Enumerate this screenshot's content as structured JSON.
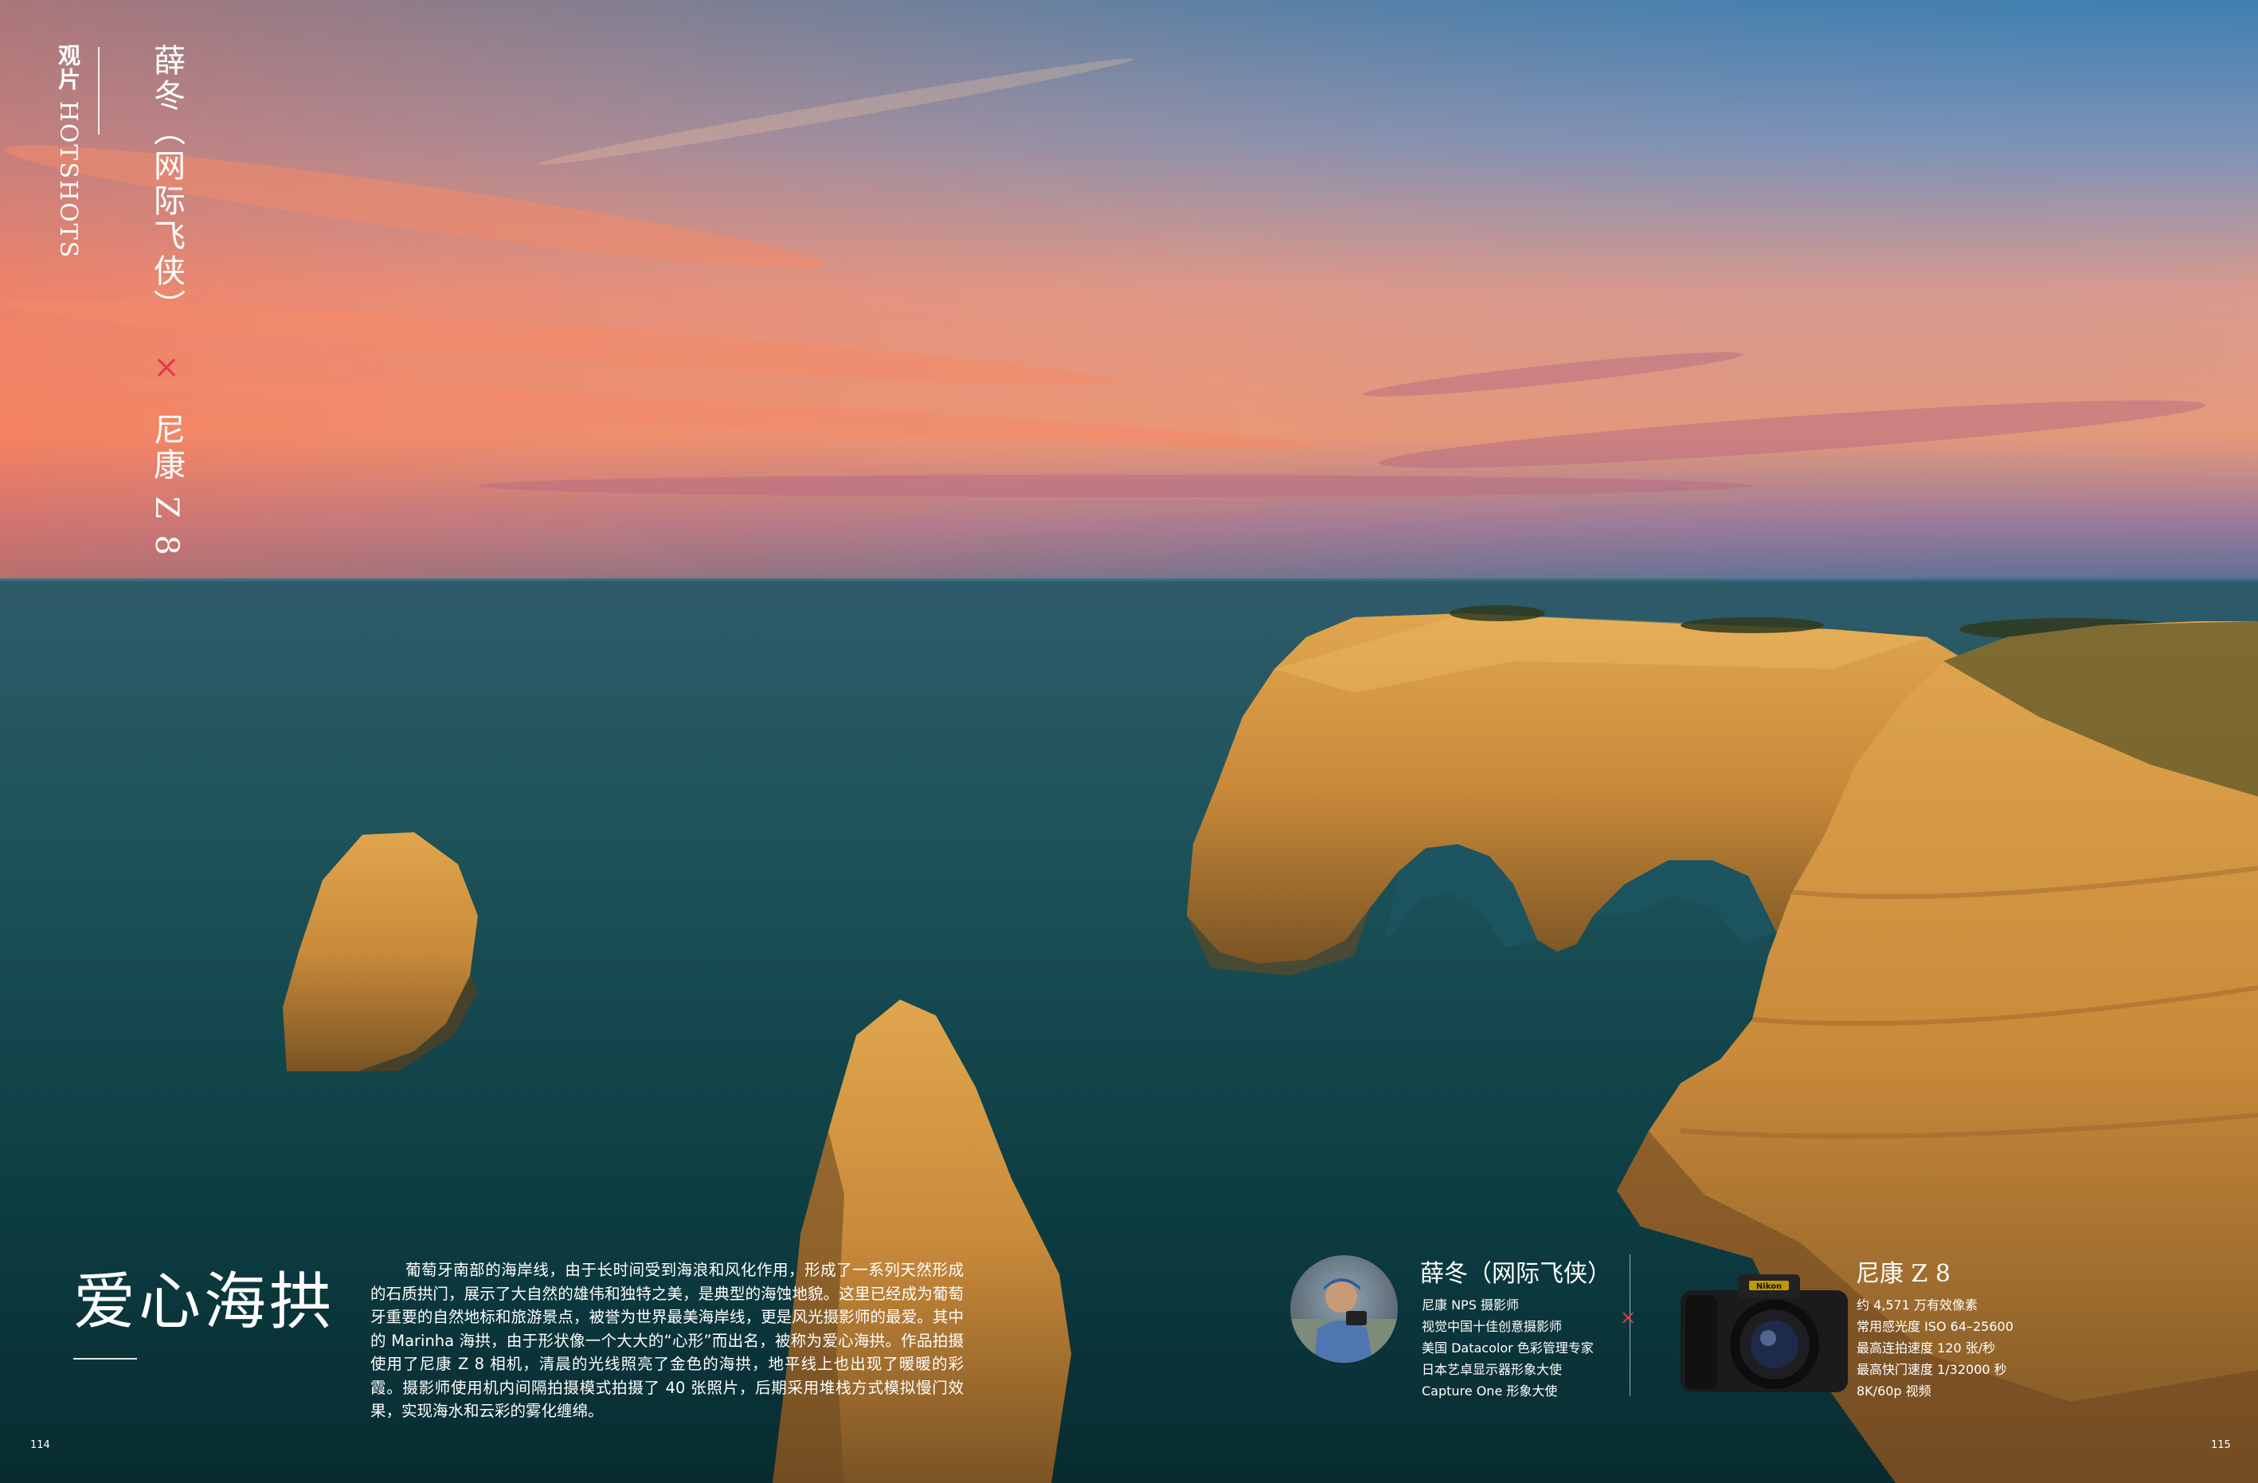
{
  "header": {
    "section_cn": "观片",
    "section_en": "HOTSHOTS",
    "author": "薛冬（网际飞侠）",
    "times": "×",
    "camera": "尼康 Z 8"
  },
  "article": {
    "title": "爱心海拱",
    "body": "葡萄牙南部的海岸线，由于长时间受到海浪和风化作用，形成了一系列天然形成的石质拱门，展示了大自然的雄伟和独特之美，是典型的海蚀地貌。这里已经成为葡萄牙重要的自然地标和旅游景点，被誉为世界最美海岸线，更是风光摄影师的最爱。其中的 Marinha 海拱，由于形状像一个大大的“心形”而出名，被称为爱心海拱。作品拍摄使用了尼康 Z 8 相机，清晨的光线照亮了金色的海拱，地平线上也出现了暖暖的彩霞。摄影师使用机内间隔拍摄模式拍摄了 40 张照片，后期采用堆栈方式模拟慢门效果，实现海水和云彩的雾化缠绵。"
  },
  "photographer": {
    "name": "薛冬（网际飞侠）",
    "lines": [
      "尼康 NPS 摄影师",
      "视觉中国十佳创意摄影师",
      "美国 Datacolor 色彩管理专家",
      "日本艺卓显示器形象大使",
      "Capture One 形象大使"
    ]
  },
  "camera": {
    "name": "尼康 Z 8",
    "brand": "Nikon",
    "lines": [
      "约 4,571 万有效像素",
      "常用感光度 ISO 64–25600",
      "最高连拍速度 120 张/秒",
      "最高快门速度 1/32000 秒",
      "8K/60p 视频"
    ]
  },
  "pages": {
    "left": "114",
    "right": "115"
  },
  "colors": {
    "accent": "#e23a4a",
    "sea": "#0f4b52",
    "rock": "#c98a3a"
  }
}
